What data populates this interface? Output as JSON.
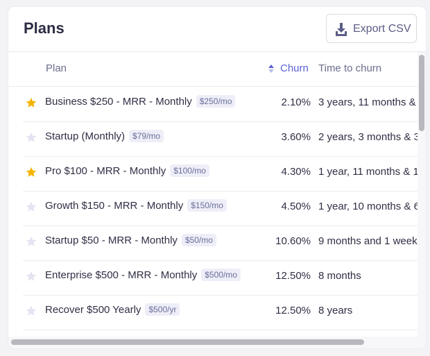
{
  "header": {
    "title": "Plans",
    "export_label": "Export CSV"
  },
  "columns": {
    "plan": "Plan",
    "churn": "Churn",
    "time_to_churn": "Time to churn"
  },
  "colors": {
    "accent": "#5b61d6",
    "star_active": "#f5b400",
    "star_inactive": "#e4e4f2"
  },
  "rows": [
    {
      "starred": true,
      "name": "Business $250 - MRR - Monthly",
      "price": "$250/mo",
      "churn": "2.10%",
      "time_to_churn": "3 years, 11 months &"
    },
    {
      "starred": false,
      "name": "Startup (Monthly)",
      "price": "$79/mo",
      "churn": "3.60%",
      "time_to_churn": "2 years, 3 months & 3"
    },
    {
      "starred": true,
      "name": "Pro $100 - MRR - Monthly",
      "price": "$100/mo",
      "churn": "4.30%",
      "time_to_churn": "1 year, 11 months & 1"
    },
    {
      "starred": false,
      "name": "Growth $150 - MRR - Monthly",
      "price": "$150/mo",
      "churn": "4.50%",
      "time_to_churn": "1 year, 10 months & 6"
    },
    {
      "starred": false,
      "name": "Startup $50 - MRR - Monthly",
      "price": "$50/mo",
      "churn": "10.60%",
      "time_to_churn": "9 months and 1 week"
    },
    {
      "starred": false,
      "name": "Enterprise $500 - MRR - Monthly",
      "price": "$500/mo",
      "churn": "12.50%",
      "time_to_churn": "8 months"
    },
    {
      "starred": false,
      "name": "Recover $500 Yearly",
      "price": "$500/yr",
      "churn": "12.50%",
      "time_to_churn": "8 years"
    }
  ]
}
